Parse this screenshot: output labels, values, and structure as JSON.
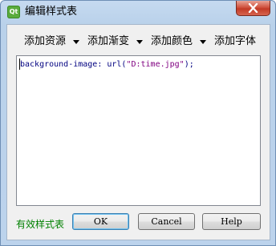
{
  "window": {
    "title": "编辑样式表",
    "app_icon": "qt-designer-icon",
    "close_icon": "close-icon"
  },
  "toolbar": {
    "items": [
      {
        "label": "添加资源",
        "icon": "dropdown-arrow-icon"
      },
      {
        "label": "添加渐变",
        "icon": "dropdown-arrow-icon"
      },
      {
        "label": "添加颜色",
        "icon": "dropdown-arrow-icon"
      },
      {
        "label": "添加字体"
      }
    ]
  },
  "editor": {
    "code_prefix": "background-image: url(",
    "code_string": "\"D:time.jpg\"",
    "code_suffix": ");"
  },
  "status": {
    "text": "有效样式表",
    "color": "#008000"
  },
  "buttons": {
    "ok": "OK",
    "cancel": "Cancel",
    "help": "Help"
  }
}
